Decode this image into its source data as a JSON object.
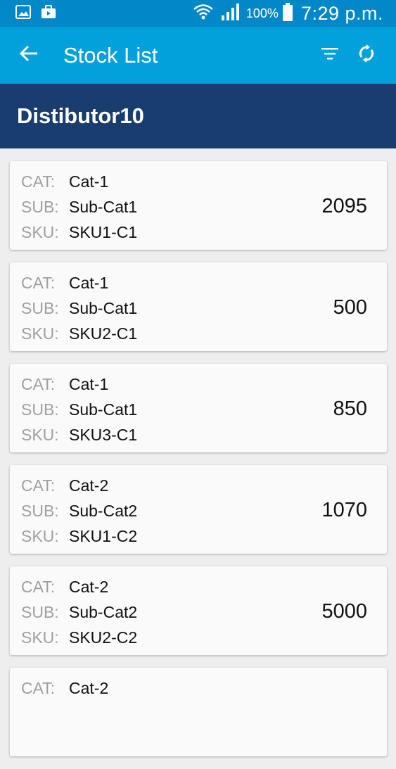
{
  "status_bar": {
    "battery_percent": "100%",
    "time": "7:29 p.m.",
    "icons": [
      "image-icon",
      "briefcase-icon",
      "wifi-icon",
      "signal-icon",
      "battery-icon"
    ],
    "color": "#0288c9"
  },
  "app_bar": {
    "title": "Stock List",
    "back_icon": "arrow-left-icon",
    "actions": [
      "filter-icon",
      "sync-icon"
    ],
    "color": "#03a1dc"
  },
  "distributor": {
    "name": "Distibutor10",
    "color": "#1a3d6f"
  },
  "labels": {
    "cat": "CAT:",
    "sub": "SUB:",
    "sku": "SKU:"
  },
  "items": [
    {
      "cat": "Cat-1",
      "sub": "Sub-Cat1",
      "sku": "SKU1-C1",
      "qty": "2095"
    },
    {
      "cat": "Cat-1",
      "sub": "Sub-Cat1",
      "sku": "SKU2-C1",
      "qty": "500"
    },
    {
      "cat": "Cat-1",
      "sub": "Sub-Cat1",
      "sku": "SKU3-C1",
      "qty": "850"
    },
    {
      "cat": "Cat-2",
      "sub": "Sub-Cat2",
      "sku": "SKU1-C2",
      "qty": "1070"
    },
    {
      "cat": "Cat-2",
      "sub": "Sub-Cat2",
      "sku": "SKU2-C2",
      "qty": "5000"
    },
    {
      "cat": "Cat-2"
    }
  ]
}
